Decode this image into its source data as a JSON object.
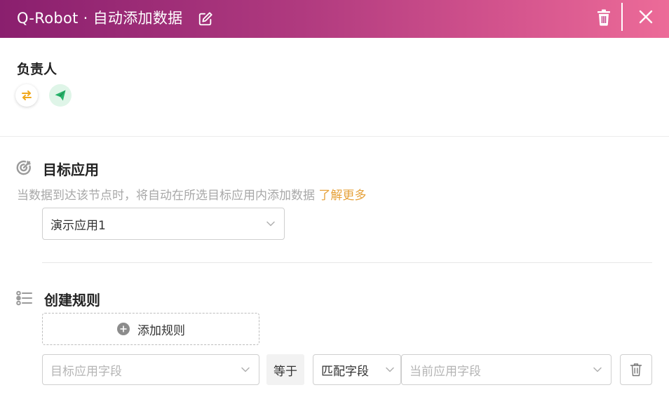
{
  "header": {
    "title": "Q-Robot · 自动添加数据",
    "edit_icon": "edit-icon",
    "delete_icon": "trash-icon",
    "close_icon": "close-icon"
  },
  "owner": {
    "label": "负责人",
    "avatars": [
      "swap-icon",
      "send-icon"
    ]
  },
  "target_app": {
    "title": "目标应用",
    "icon": "target-icon",
    "description": "当数据到达该节点时，将自动在所选目标应用内添加数据",
    "learn_more": "了解更多",
    "selected_app": "演示应用1"
  },
  "rules": {
    "title": "创建规则",
    "icon": "list-icon",
    "add_rule_label": "添加规则",
    "row": {
      "target_field_placeholder": "目标应用字段",
      "operator": "等于",
      "match_type": "匹配字段",
      "current_field_placeholder": "当前应用字段"
    }
  },
  "colors": {
    "header_start": "#8a1f6e",
    "header_end": "#ec6b98",
    "link": "#e6a23c",
    "send_icon": "#27b36a",
    "swap_icon": "#f0a81c"
  }
}
